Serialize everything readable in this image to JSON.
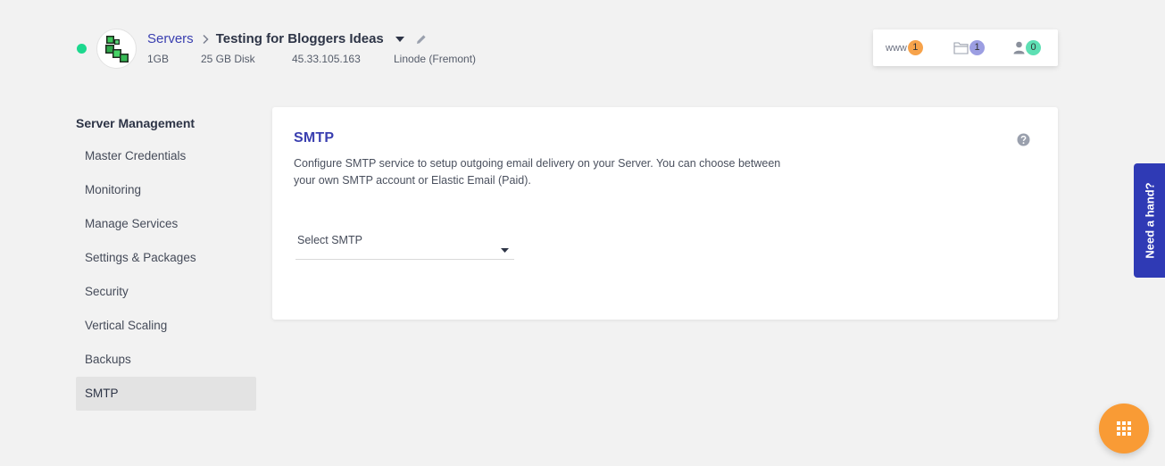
{
  "header": {
    "breadcrumb_root": "Servers",
    "server_name": "Testing for Bloggers Ideas",
    "meta": {
      "size": "1GB",
      "disk": "25 GB Disk",
      "ip": "45.33.105.163",
      "provider": "Linode (Fremont)"
    },
    "status_color": "#1dd88e"
  },
  "counters": {
    "www_label": "www",
    "www_count": "1",
    "files_count": "1",
    "users_count": "0",
    "colors": {
      "www": "#f7a34b",
      "files": "#9c9ee2",
      "users": "#5ee0b4"
    }
  },
  "sidebar": {
    "title": "Server Management",
    "items": [
      {
        "label": "Master Credentials",
        "active": false
      },
      {
        "label": "Monitoring",
        "active": false
      },
      {
        "label": "Manage Services",
        "active": false
      },
      {
        "label": "Settings & Packages",
        "active": false
      },
      {
        "label": "Security",
        "active": false
      },
      {
        "label": "Vertical Scaling",
        "active": false
      },
      {
        "label": "Backups",
        "active": false
      },
      {
        "label": "SMTP",
        "active": true
      }
    ]
  },
  "main": {
    "title": "SMTP",
    "description": "Configure SMTP service to setup outgoing email delivery on your Server. You can choose between your own SMTP account or Elastic Email (Paid).",
    "select_placeholder": "Select SMTP"
  },
  "help_tab": {
    "label": "Need a hand?"
  },
  "theme": {
    "accent": "#3a3fb0",
    "help_tab": "#2f3ab5",
    "fab": "#f99b35"
  },
  "icons": {
    "logo": "cube-stack-logo",
    "breadcrumb_separator": "chevron-right-icon",
    "server_menu": "caret-down-icon",
    "edit": "pencil-icon",
    "files": "folder-icon",
    "users": "user-icon",
    "help": "question-circle-icon",
    "fab": "grid-icon"
  }
}
